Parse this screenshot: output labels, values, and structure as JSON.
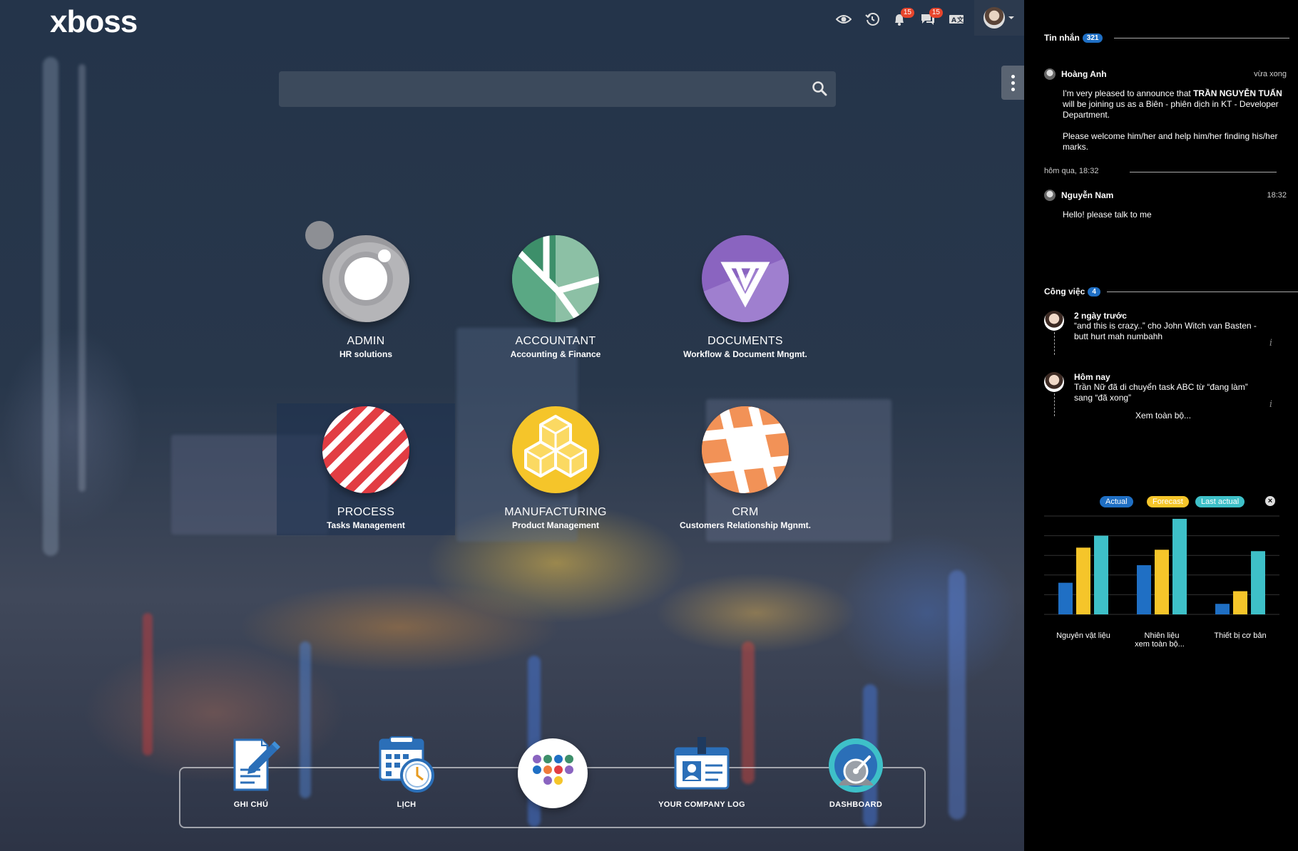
{
  "app": {
    "logo_text": "xboss"
  },
  "header": {
    "icons": [
      "eye-icon",
      "history-icon",
      "bell-icon",
      "chat-icon",
      "translate-icon"
    ],
    "notifications_count": "15",
    "messages_count": "15"
  },
  "search": {
    "placeholder": "",
    "value": ""
  },
  "apps": [
    {
      "name": "ADMIN",
      "sub": "HR solutions",
      "color": "#9a9a9e"
    },
    {
      "name": "ACCOUNTANT",
      "sub": "Accounting & Finance",
      "color": "#3d8f6a"
    },
    {
      "name": "DOCUMENTS",
      "sub": "Workflow & Document Mngmt.",
      "color": "#8a64c0"
    },
    {
      "name": "PROCESS",
      "sub": "Tasks Management",
      "color": "#e23d43"
    },
    {
      "name": "MANUFACTURING",
      "sub": "Product Management",
      "color": "#f5c52a"
    },
    {
      "name": "CRM",
      "sub": "Customers Relationship Mgnmt.",
      "color": "#ef7a3a"
    }
  ],
  "dock": [
    {
      "label": "GHI CHÚ"
    },
    {
      "label": "LỊCH"
    },
    {
      "label": ""
    },
    {
      "label": "YOUR COMPANY LOG"
    },
    {
      "label": "DASHBOARD"
    }
  ],
  "panel": {
    "messages_title": "Tin nhắn",
    "messages_count": "321",
    "msg1": {
      "user": "Hoàng Anh",
      "time": "vừa xong",
      "body1": "I'm very pleased to announce that",
      "body1_bold": "TRẦN NGUYỄN TUẤN",
      "body1_rest": "will be joining us as a Biên - phiên dịch in KT - Developer Department.",
      "body2": "Please welcome him/her and help him/her finding his/her marks."
    },
    "divider_label": "hôm qua, 18:32",
    "msg2": {
      "user": "Nguyễn Nam",
      "time": "18:32",
      "body": "Hello! please talk to me"
    },
    "tasks_title": "Công việc",
    "tasks_count": "4",
    "task1": {
      "title": "2 ngày trước",
      "desc": "“and this is crazy..” cho John Witch van Basten - butt hurt mah numbahh"
    },
    "task2": {
      "title": "Hôm nay",
      "desc": "Trần Nữ đã di chuyển task ABC từ “đang làm” sang “đã xong”"
    },
    "view_all": "Xem toàn bộ...",
    "view_all_chart": "xem toàn bộ..."
  },
  "chart_data": {
    "type": "bar",
    "categories": [
      "Nguyên vật liệu",
      "Nhiên liệu",
      "Thiết bị cơ bản"
    ],
    "series": [
      {
        "name": "Actual",
        "color": "#1f6fc4",
        "values": [
          45,
          70,
          15
        ]
      },
      {
        "name": "Forecast",
        "color": "#f5c52a",
        "values": [
          95,
          92,
          33
        ]
      },
      {
        "name": "Last actual",
        "color": "#3ec0c8",
        "values": [
          112,
          136,
          90
        ]
      }
    ],
    "ylim": [
      0,
      140
    ],
    "grid": true,
    "legend": "top"
  }
}
